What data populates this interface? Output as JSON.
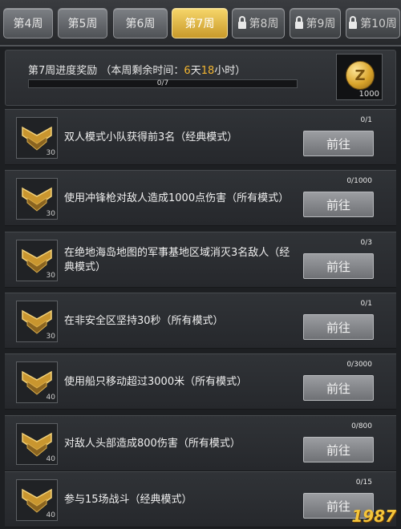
{
  "tabs": [
    {
      "label": "第4周",
      "locked": false,
      "active": false
    },
    {
      "label": "第5周",
      "locked": false,
      "active": false
    },
    {
      "label": "第6周",
      "locked": false,
      "active": false
    },
    {
      "label": "第7周",
      "locked": false,
      "active": true
    },
    {
      "label": "第8周",
      "locked": true,
      "active": false
    },
    {
      "label": "第9周",
      "locked": true,
      "active": false
    },
    {
      "label": "第10周",
      "locked": true,
      "active": false
    }
  ],
  "header": {
    "title_prefix": "第7周进度奖励 （本周剩余时间：",
    "days": "6",
    "days_unit": "天",
    "hours": "18",
    "hours_unit": "小时）",
    "progress_text": "0/7",
    "progress_fraction": 0,
    "reward_qty": "1000"
  },
  "go_label": "前往",
  "tasks": [
    {
      "desc": "双人模式小队获得前3名（经典模式）",
      "count": "0/1",
      "badge": "30"
    },
    {
      "desc": "使用冲锋枪对敌人造成1000点伤害（所有模式）",
      "count": "0/1000",
      "badge": "30"
    },
    {
      "desc": "在绝地海岛地图的军事基地区域消灭3名敌人（经典模式）",
      "count": "0/3",
      "badge": "30"
    },
    {
      "desc": "在非安全区坚持30秒（所有模式）",
      "count": "0/1",
      "badge": "30"
    },
    {
      "desc": "使用船只移动超过3000米（所有模式）",
      "count": "0/3000",
      "badge": "40"
    },
    {
      "desc": "对敌人头部造成800伤害（所有模式）",
      "count": "0/800",
      "badge": "40"
    },
    {
      "desc": "参与15场战斗（经典模式）",
      "count": "0/15",
      "badge": "40"
    }
  ],
  "watermark": "1987",
  "colors": {
    "accent": "#f2b531",
    "active_tab": "#e6b94a",
    "button": "#8a8c90"
  }
}
